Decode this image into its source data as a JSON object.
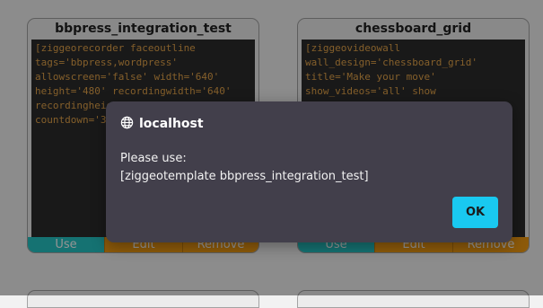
{
  "cards": [
    {
      "title": "bbpress_integration_test",
      "code": "[ziggeorecorder faceoutline\ntags='bbpress,wordpress'\nallowscreen='false' width='640'\nheight='480' recordingwidth='640'\nrecordingheight='480' timelimit='0'\ncountdown='3'",
      "actions": {
        "use": "Use",
        "edit": "Edit",
        "remove": "Remove"
      }
    },
    {
      "title": "chessboard_grid",
      "code": "[ziggeovideowall\nwall_design='chessboard_grid'\ntitle='Make your move'\nshow_videos='all' show\nvideos_per_page='2'",
      "actions": {
        "use": "Use",
        "edit": "Edit",
        "remove": "Remove"
      }
    }
  ],
  "dialog": {
    "origin": "localhost",
    "message_line1": "Please use:",
    "message_line2": "[ziggeotemplate bbpress_integration_test]",
    "ok_label": "OK"
  },
  "colors": {
    "use_button": "#25c4c4",
    "edit_button": "#f39c12",
    "dialog_bg": "#423f4b",
    "ok_button": "#19c9f0"
  }
}
